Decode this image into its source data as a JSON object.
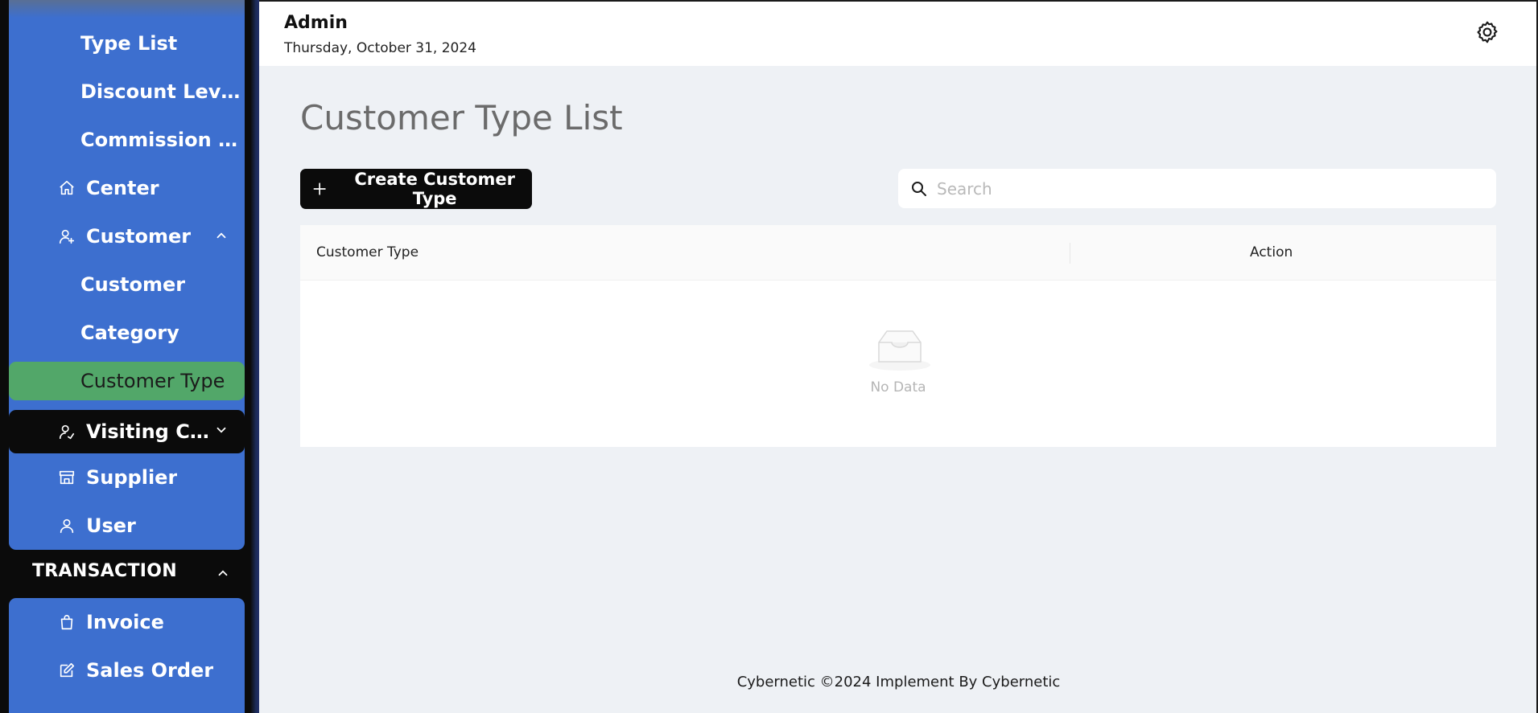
{
  "sidebar": {
    "items": [
      {
        "label": "Type List"
      },
      {
        "label": "Discount Levels"
      },
      {
        "label": "Commission L..."
      },
      {
        "label": "Center"
      },
      {
        "label": "Customer"
      },
      {
        "label": "Customer"
      },
      {
        "label": "Category"
      },
      {
        "label": "Customer Type"
      },
      {
        "label": "Visiting Cust..."
      },
      {
        "label": "Supplier"
      },
      {
        "label": "User"
      },
      {
        "label": "Invoice"
      },
      {
        "label": "Sales Order"
      }
    ],
    "section_transaction": "TRANSACTION",
    "colors": {
      "nav_bg": "#3d6fcf",
      "active_bg": "#52a769",
      "dark_bg": "#0b0b0b"
    }
  },
  "header": {
    "user": "Admin",
    "date": "Thursday, October 31, 2024"
  },
  "main": {
    "title": "Customer Type List",
    "create_button": "Create Customer Type",
    "search_placeholder": "Search",
    "table": {
      "columns": [
        "Customer Type",
        "Action"
      ],
      "rows": [],
      "empty_text": "No Data"
    }
  },
  "footer": {
    "text": "Cybernetic ©2024 Implement By Cybernetic"
  }
}
